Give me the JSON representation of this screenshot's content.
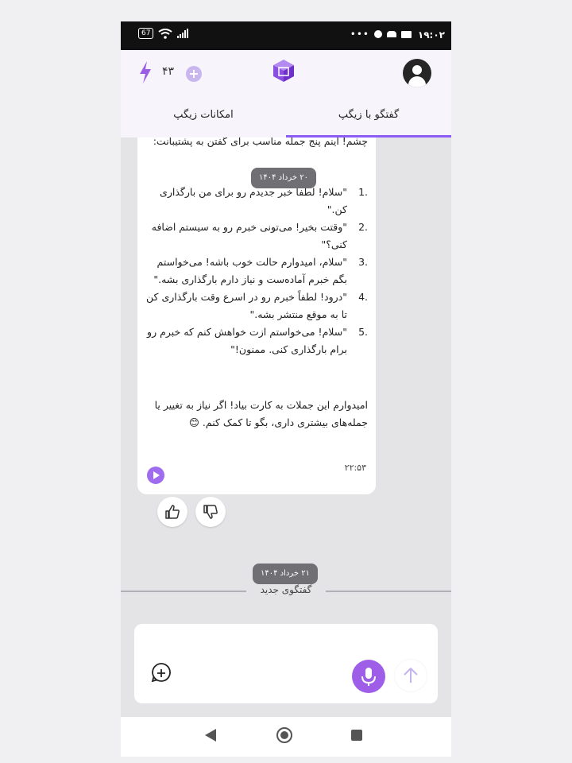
{
  "status_bar": {
    "time": "۱۹:۰۲",
    "battery": "67"
  },
  "header": {
    "credits": "۴۳"
  },
  "tabs": [
    {
      "label": "گفتگو با زیگپ",
      "active": true
    },
    {
      "label": "امکانات زیگپ",
      "active": false
    }
  ],
  "message": {
    "intro": "چشم! اینم پنج جمله مناسب برای گفتن به پشتیبانت:",
    "items": [
      {
        "num": "1.",
        "text": "\"سلام! لطفاً خبر جدیدم رو برای من بارگذاری کن.\""
      },
      {
        "num": "2.",
        "text": "\"وقتت بخیر! می‌تونی خبرم رو به سیستم اضافه کنی؟\""
      },
      {
        "num": "3.",
        "text": "\"سلام، امیدوارم حالت خوب باشه! می‌خواستم بگم خبرم آماده‌ست و نیاز دارم بارگذاری بشه.\""
      },
      {
        "num": "4.",
        "text": "\"درود! لطفاً خبرم رو در اسرع وقت بارگذاری کن تا به موقع منتشر بشه.\""
      },
      {
        "num": "5.",
        "text": "\"سلام! می‌خواستم ازت خواهش کنم که خبرم رو برام بارگذاری کنی. ممنون!\""
      }
    ],
    "outro": "امیدوارم این جملات به کارت بیاد! اگر نیاز به تغییر یا جمله‌های بیشتری داری، بگو تا کمک کنم. 😊",
    "time": "۲۲:۵۳"
  },
  "dates": {
    "first": "۲۰ خرداد ۱۴۰۴",
    "second": "۲۱ خرداد ۱۴۰۴"
  },
  "divider_label": "گفتگوی جدید",
  "composer": {
    "placeholder": ""
  },
  "colors": {
    "accent": "#9f5ee8",
    "accent_light": "#c9b6ef",
    "date_chip": "#6f6f74"
  },
  "icons": [
    "battery-icon",
    "wifi-icon",
    "signal-icon",
    "bolt-icon",
    "plus-icon",
    "logo-cube-icon",
    "avatar-icon",
    "play-icon",
    "thumbs-up-icon",
    "thumbs-down-icon",
    "new-chat-icon",
    "mic-icon",
    "send-arrow-icon",
    "nav-back-icon",
    "nav-home-icon",
    "nav-recent-icon"
  ]
}
